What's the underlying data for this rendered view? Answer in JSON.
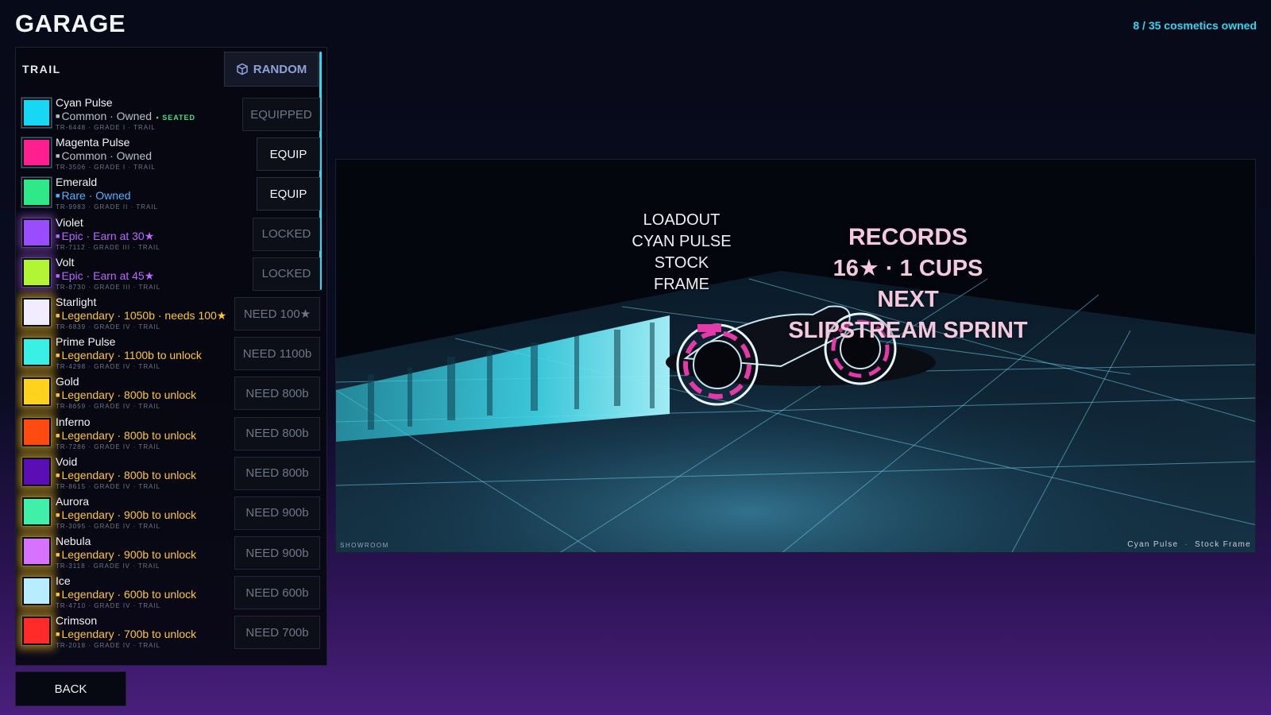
{
  "header": {
    "title": "GARAGE",
    "owned_count": "8 / 35 cosmetics owned"
  },
  "panel": {
    "title": "TRAIL",
    "random_label": "RANDOM",
    "items": [
      {
        "name": "Cyan Pulse",
        "status": "Common · Owned",
        "seated": "SEATED",
        "code": "TR-6448 · GRADE I · TRAIL",
        "color": "#16d8f4",
        "rarity": "common",
        "action": "EQUIPPED"
      },
      {
        "name": "Magenta Pulse",
        "status": "Common · Owned",
        "seated": "",
        "code": "TR-3506 · GRADE I · TRAIL",
        "color": "#ff1f8f",
        "rarity": "common",
        "action": "EQUIP"
      },
      {
        "name": "Emerald",
        "status": "Rare · Owned",
        "seated": "",
        "code": "TR-9983 · GRADE II · TRAIL",
        "color": "#2fe888",
        "rarity": "rare",
        "action": "EQUIP"
      },
      {
        "name": "Violet",
        "status": "Epic · Earn at 30★",
        "seated": "",
        "code": "TR-7112 · GRADE III · TRAIL",
        "color": "#9a4cff",
        "rarity": "epic",
        "action": "LOCKED"
      },
      {
        "name": "Volt",
        "status": "Epic · Earn at 45★",
        "seated": "",
        "code": "TR-8730 · GRADE III · TRAIL",
        "color": "#b2f534",
        "rarity": "epic",
        "action": "LOCKED"
      },
      {
        "name": "Starlight",
        "status": "Legendary · 1050b · needs 100★",
        "seated": "",
        "code": "TR-6839 · GRADE IV · TRAIL",
        "color": "#f1ecff",
        "rarity": "leg",
        "action": "NEED 100★"
      },
      {
        "name": "Prime Pulse",
        "status": "Legendary · 1100b to unlock",
        "seated": "",
        "code": "TR-4298 · GRADE IV · TRAIL",
        "color": "#39f0e4",
        "rarity": "leg",
        "action": "NEED 1100b"
      },
      {
        "name": "Gold",
        "status": "Legendary · 800b to unlock",
        "seated": "",
        "code": "TR-8659 · GRADE IV · TRAIL",
        "color": "#ffd21e",
        "rarity": "leg",
        "action": "NEED 800b"
      },
      {
        "name": "Inferno",
        "status": "Legendary · 800b to unlock",
        "seated": "",
        "code": "TR-7286 · GRADE IV · TRAIL",
        "color": "#ff4a12",
        "rarity": "leg",
        "action": "NEED 800b"
      },
      {
        "name": "Void",
        "status": "Legendary · 800b to unlock",
        "seated": "",
        "code": "TR-8615 · GRADE IV · TRAIL",
        "color": "#5a0fb4",
        "rarity": "leg",
        "action": "NEED 800b"
      },
      {
        "name": "Aurora",
        "status": "Legendary · 900b to unlock",
        "seated": "",
        "code": "TR-3095 · GRADE IV · TRAIL",
        "color": "#41f0a8",
        "rarity": "leg",
        "action": "NEED 900b"
      },
      {
        "name": "Nebula",
        "status": "Legendary · 900b to unlock",
        "seated": "",
        "code": "TR-3118 · GRADE IV · TRAIL",
        "color": "#d772ff",
        "rarity": "leg",
        "action": "NEED 900b"
      },
      {
        "name": "Ice",
        "status": "Legendary · 600b to unlock",
        "seated": "",
        "code": "TR-4710 · GRADE IV · TRAIL",
        "color": "#b8ecff",
        "rarity": "leg",
        "action": "NEED 600b"
      },
      {
        "name": "Crimson",
        "status": "Legendary · 700b to unlock",
        "seated": "",
        "code": "TR-2018 · GRADE IV · TRAIL",
        "color": "#ff2a2a",
        "rarity": "leg",
        "action": "NEED 700b"
      }
    ]
  },
  "back_label": "BACK",
  "showroom": {
    "label": "SHOWROOM",
    "caption_trail": "Cyan Pulse",
    "caption_sep": "·",
    "caption_frame": "Stock Frame",
    "loadout": [
      "LOADOUT",
      "CYAN PULSE",
      "STOCK FRAME"
    ],
    "records": [
      "RECORDS",
      "16★ · 1 CUPS",
      "NEXT",
      "SLIPSTREAM SPRINT"
    ]
  },
  "colors": {
    "accent": "#2fd6f2",
    "common": "#b9bfca",
    "rare": "#53b2ff",
    "epic": "#b868ff",
    "legendary": "#ffc733",
    "seated": "#45e08a"
  }
}
